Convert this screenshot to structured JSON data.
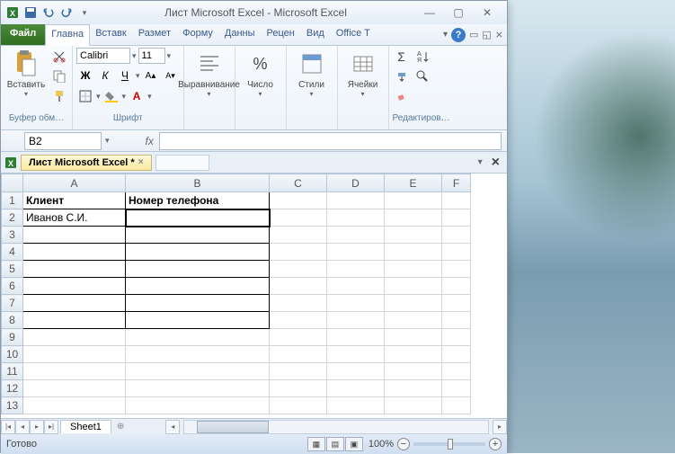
{
  "window": {
    "title": "Лист Microsoft Excel  -  Microsoft Excel"
  },
  "tabs": {
    "file": "Файл",
    "items": [
      "Главна",
      "Вставк",
      "Размет",
      "Форму",
      "Данны",
      "Рецен",
      "Вид",
      "Office T"
    ]
  },
  "ribbon": {
    "clipboard": {
      "paste": "Вставить",
      "label": "Буфер обм…"
    },
    "font": {
      "name": "Calibri",
      "size": "11",
      "label": "Шрифт"
    },
    "alignment": {
      "label": "Выравнивание"
    },
    "number": {
      "label": "Число"
    },
    "styles": {
      "label": "Стили"
    },
    "cells": {
      "label": "Ячейки"
    },
    "editing": {
      "label": "Редактиров…"
    }
  },
  "formula": {
    "namebox": "B2"
  },
  "doc": {
    "tab": "Лист Microsoft Excel *"
  },
  "grid": {
    "cols": [
      "A",
      "B",
      "C",
      "D",
      "E",
      "F"
    ],
    "rows": [
      "1",
      "2",
      "3",
      "4",
      "5",
      "6",
      "7",
      "8",
      "9",
      "10",
      "11",
      "12",
      "13"
    ],
    "data": {
      "A1": "Клиент",
      "B1": "Номер телефона",
      "A2": "Иванов С.И."
    }
  },
  "sheet": {
    "name": "Sheet1"
  },
  "status": {
    "text": "Готово",
    "zoom": "100%"
  }
}
